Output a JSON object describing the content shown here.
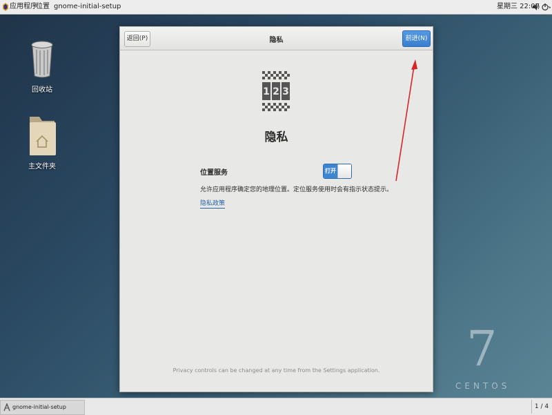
{
  "top_panel": {
    "apps_label": "应用程序",
    "places_label": "位置",
    "app_name": "gnome-initial-setup",
    "clock": "星期三 22:07"
  },
  "desktop": {
    "icons": [
      {
        "label": "回收站",
        "icon": "trash-icon"
      },
      {
        "label": "主文件夹",
        "icon": "home-folder-icon"
      }
    ],
    "brand_number": "7",
    "brand_word": "CENTOS"
  },
  "dialog": {
    "back_label": "返回(P)",
    "title": "隐私",
    "next_label": "前进(N)",
    "heading": "隐私",
    "location_label": "位置服务",
    "switch_label": "打开",
    "switch_on": true,
    "location_desc": "允许应用程序确定您的地理位置。定位服务使用时会有指示状态提示。",
    "privacy_link": "隐私政策",
    "footer_note": "Privacy controls can be changed at any time from the Settings application.",
    "emblem": "privacy-emblem-icon",
    "emblem_digits": [
      "1",
      "2",
      "3"
    ]
  },
  "bottom_panel": {
    "task_label": "gnome-initial-setup",
    "workspace": "1 / 4"
  },
  "colors": {
    "accent": "#3d84d3",
    "annotation": "#d8232a"
  }
}
